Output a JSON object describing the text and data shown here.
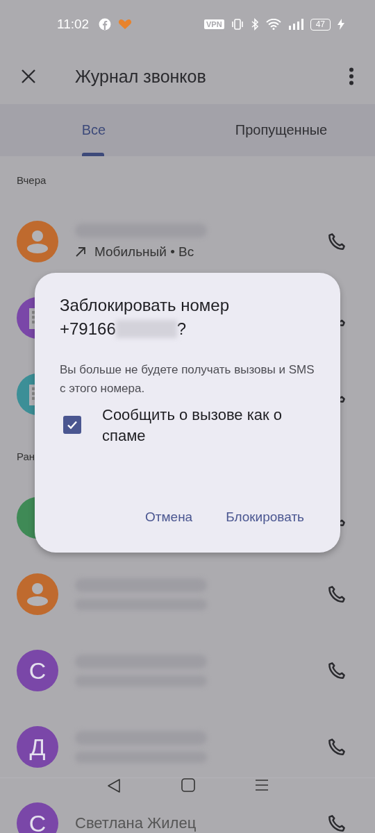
{
  "status_bar": {
    "time": "11:02",
    "vpn": "VPN",
    "battery": "47"
  },
  "app_bar": {
    "title": "Журнал звонков"
  },
  "tabs": [
    {
      "label": "Все",
      "selected": true
    },
    {
      "label": "Пропущенные",
      "selected": false
    }
  ],
  "sections": [
    {
      "header": "Вчера",
      "rows": [
        {
          "kind": "person",
          "color": "#bf6a2e",
          "blurred": true,
          "detail": "Мобильный • Вс"
        },
        {
          "kind": "building",
          "color": "#7a47a8"
        },
        {
          "kind": "building",
          "color": "#3c8f97"
        }
      ]
    },
    {
      "header": "Ран",
      "rows": [
        {
          "kind": "blank",
          "color": "#3f8a56"
        },
        {
          "kind": "person",
          "color": "#bf6a2e",
          "blurred": true
        },
        {
          "kind": "initial",
          "initial": "С",
          "color": "#7a47a8",
          "blurred": true
        },
        {
          "kind": "initial",
          "initial": "Д",
          "color": "#7a47a8",
          "blurred": true
        },
        {
          "kind": "initial",
          "initial": "С",
          "color": "#7a47a8",
          "name": "Светлана Жилец"
        }
      ]
    }
  ],
  "dialog": {
    "title": "Заблокировать номер",
    "number_prefix": "+79166",
    "number_suffix": "?",
    "message": "Вы больше не будете получать вызовы и SMS с этого номера.",
    "checkbox": {
      "label": "Сообщить о вызове как о спаме",
      "checked": true
    },
    "buttons": [
      "Отмена",
      "Блокировать"
    ]
  }
}
